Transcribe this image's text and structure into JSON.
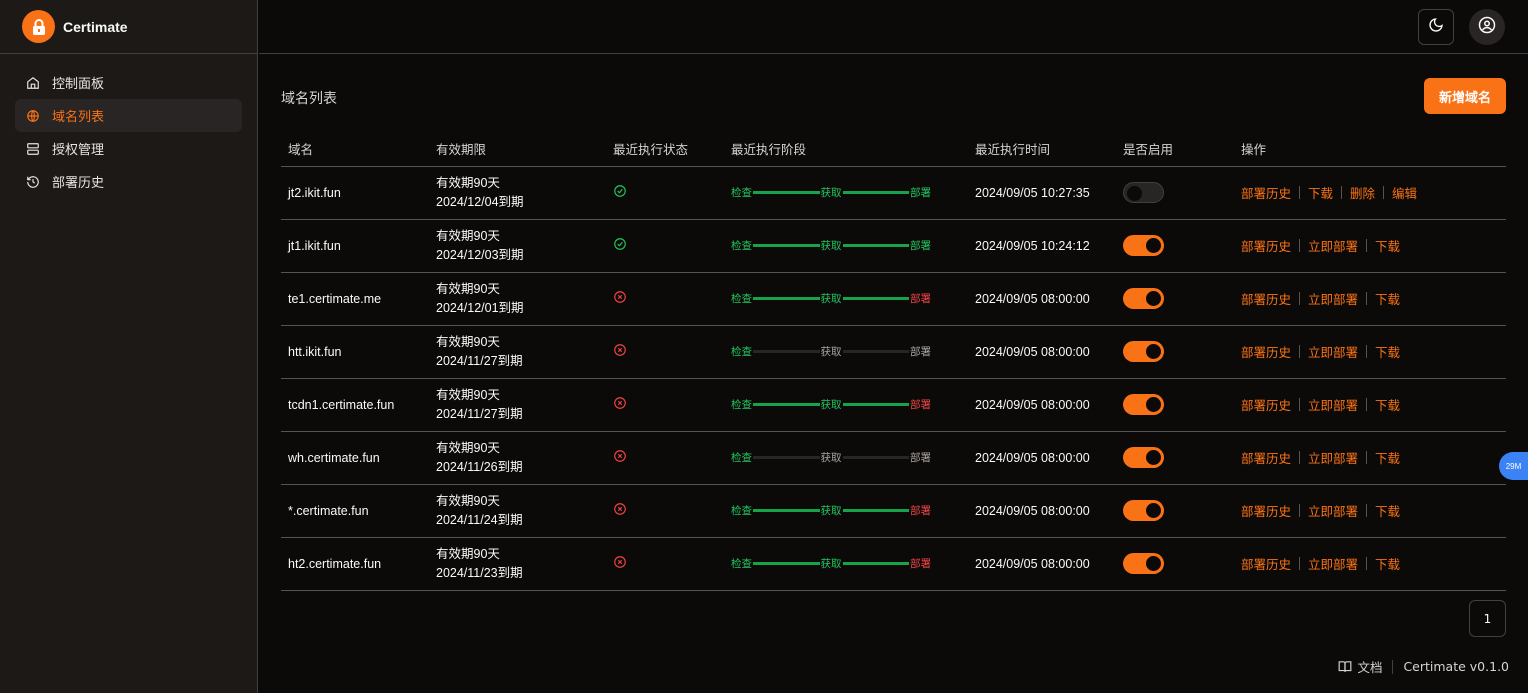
{
  "brand": {
    "name": "Certimate"
  },
  "sidebar": {
    "items": [
      {
        "label": "控制面板",
        "icon": "home-icon",
        "active": false
      },
      {
        "label": "域名列表",
        "icon": "globe-icon",
        "active": true
      },
      {
        "label": "授权管理",
        "icon": "server-icon",
        "active": false
      },
      {
        "label": "部署历史",
        "icon": "history-icon",
        "active": false
      }
    ]
  },
  "header": {
    "theme_icon": "moon-icon",
    "user_icon": "user-circle-icon"
  },
  "page": {
    "title": "域名列表",
    "add_button": "新增域名"
  },
  "table": {
    "columns": [
      "域名",
      "有效期限",
      "最近执行状态",
      "最近执行阶段",
      "最近执行时间",
      "是否启用",
      "操作"
    ],
    "stage_labels": [
      "检查",
      "获取",
      "部署"
    ],
    "rows": [
      {
        "domain": "jt2.ikit.fun",
        "validity": "有效期90天",
        "expire": "2024/12/04到期",
        "status": "success",
        "stage": [
          "green",
          "green",
          "green"
        ],
        "bars": [
          "g",
          "g"
        ],
        "time": "2024/09/05 10:27:35",
        "enabled": false,
        "actions": [
          "部署历史",
          "下载",
          "删除",
          "编辑"
        ]
      },
      {
        "domain": "jt1.ikit.fun",
        "validity": "有效期90天",
        "expire": "2024/12/03到期",
        "status": "success",
        "stage": [
          "green",
          "green",
          "green"
        ],
        "bars": [
          "g",
          "g"
        ],
        "time": "2024/09/05 10:24:12",
        "enabled": true,
        "actions": [
          "部署历史",
          "立即部署",
          "下载"
        ]
      },
      {
        "domain": "te1.certimate.me",
        "validity": "有效期90天",
        "expire": "2024/12/01到期",
        "status": "failed",
        "stage": [
          "green",
          "green",
          "red"
        ],
        "bars": [
          "g",
          "g"
        ],
        "time": "2024/09/05 08:00:00",
        "enabled": true,
        "actions": [
          "部署历史",
          "立即部署",
          "下载"
        ]
      },
      {
        "domain": "htt.ikit.fun",
        "validity": "有效期90天",
        "expire": "2024/11/27到期",
        "status": "failed",
        "stage": [
          "green",
          "grey",
          "grey"
        ],
        "bars": [
          "n",
          "n"
        ],
        "time": "2024/09/05 08:00:00",
        "enabled": true,
        "actions": [
          "部署历史",
          "立即部署",
          "下载"
        ]
      },
      {
        "domain": "tcdn1.certimate.fun",
        "validity": "有效期90天",
        "expire": "2024/11/27到期",
        "status": "failed",
        "stage": [
          "green",
          "green",
          "red"
        ],
        "bars": [
          "g",
          "g"
        ],
        "time": "2024/09/05 08:00:00",
        "enabled": true,
        "actions": [
          "部署历史",
          "立即部署",
          "下载"
        ]
      },
      {
        "domain": "wh.certimate.fun",
        "validity": "有效期90天",
        "expire": "2024/11/26到期",
        "status": "failed",
        "stage": [
          "green",
          "grey",
          "grey"
        ],
        "bars": [
          "n",
          "n"
        ],
        "time": "2024/09/05 08:00:00",
        "enabled": true,
        "actions": [
          "部署历史",
          "立即部署",
          "下载"
        ]
      },
      {
        "domain": "*.certimate.fun",
        "validity": "有效期90天",
        "expire": "2024/11/24到期",
        "status": "failed",
        "stage": [
          "green",
          "green",
          "red"
        ],
        "bars": [
          "g",
          "g"
        ],
        "time": "2024/09/05 08:00:00",
        "enabled": true,
        "actions": [
          "部署历史",
          "立即部署",
          "下载"
        ]
      },
      {
        "domain": "ht2.certimate.fun",
        "validity": "有效期90天",
        "expire": "2024/11/23到期",
        "status": "failed",
        "stage": [
          "green",
          "green",
          "red"
        ],
        "bars": [
          "g",
          "g"
        ],
        "time": "2024/09/05 08:00:00",
        "enabled": true,
        "actions": [
          "部署历史",
          "立即部署",
          "下载"
        ]
      }
    ]
  },
  "pagination": {
    "current": "1"
  },
  "footer": {
    "docs": "文档",
    "version": "Certimate v0.1.0"
  },
  "overlay_badge": "29M",
  "colors": {
    "accent": "#f97316",
    "success": "#22c55e",
    "danger": "#ef4444"
  }
}
